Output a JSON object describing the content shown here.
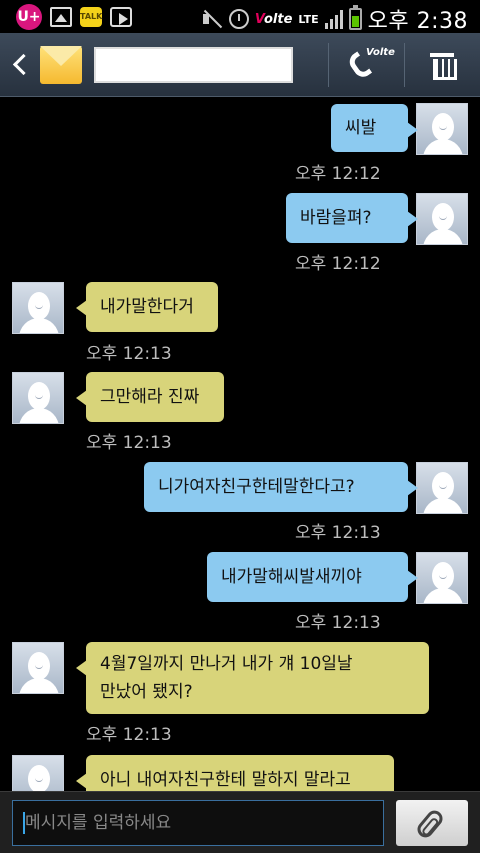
{
  "status_bar": {
    "left_icons": [
      "uplus-icon",
      "gallery-icon",
      "kakaotalk-icon",
      "play-store-icon"
    ],
    "uplus_text": "U+",
    "talk_text": "TALK",
    "volte_label": "Volte",
    "network_type": "LTE",
    "time": "오후 2:38",
    "battery_level_fraction": 0.6
  },
  "header": {
    "back_icon": "chevron-left-icon",
    "message_icon": "envelope-icon",
    "recipient_value": "",
    "call_icon": "volte-call-icon",
    "call_label": "Volte",
    "delete_icon": "trash-icon",
    "colors": {
      "background": "#2f3a48"
    }
  },
  "messages": [
    {
      "direction": "sent",
      "text": "씨발",
      "time": "오후 12:12"
    },
    {
      "direction": "sent",
      "text": "바람을펴?",
      "time": "오후 12:12"
    },
    {
      "direction": "received",
      "text": "내가말한다거",
      "time": "오후 12:13"
    },
    {
      "direction": "received",
      "text": "그만해라 진짜",
      "time": "오후 12:13"
    },
    {
      "direction": "sent",
      "text": "니가여자친구한테말한다고?",
      "time": "오후 12:13"
    },
    {
      "direction": "sent",
      "text": "내가말해씨발새끼야",
      "time": "오후 12:13"
    },
    {
      "direction": "received",
      "text_line1": "4월7일까지 만나거 내가 걔 10일날",
      "text_line2": "만났어 됐지?",
      "time": "오후 12:13"
    },
    {
      "direction": "received",
      "text": "아니 내여자친구한테 말하지 말라고",
      "time": ""
    }
  ],
  "bubble_colors": {
    "sent": "#8ccaf0",
    "received": "#d8d47a"
  },
  "composer": {
    "placeholder": "메시지를 입력하세요",
    "value": "",
    "attach_icon": "paperclip-icon"
  }
}
